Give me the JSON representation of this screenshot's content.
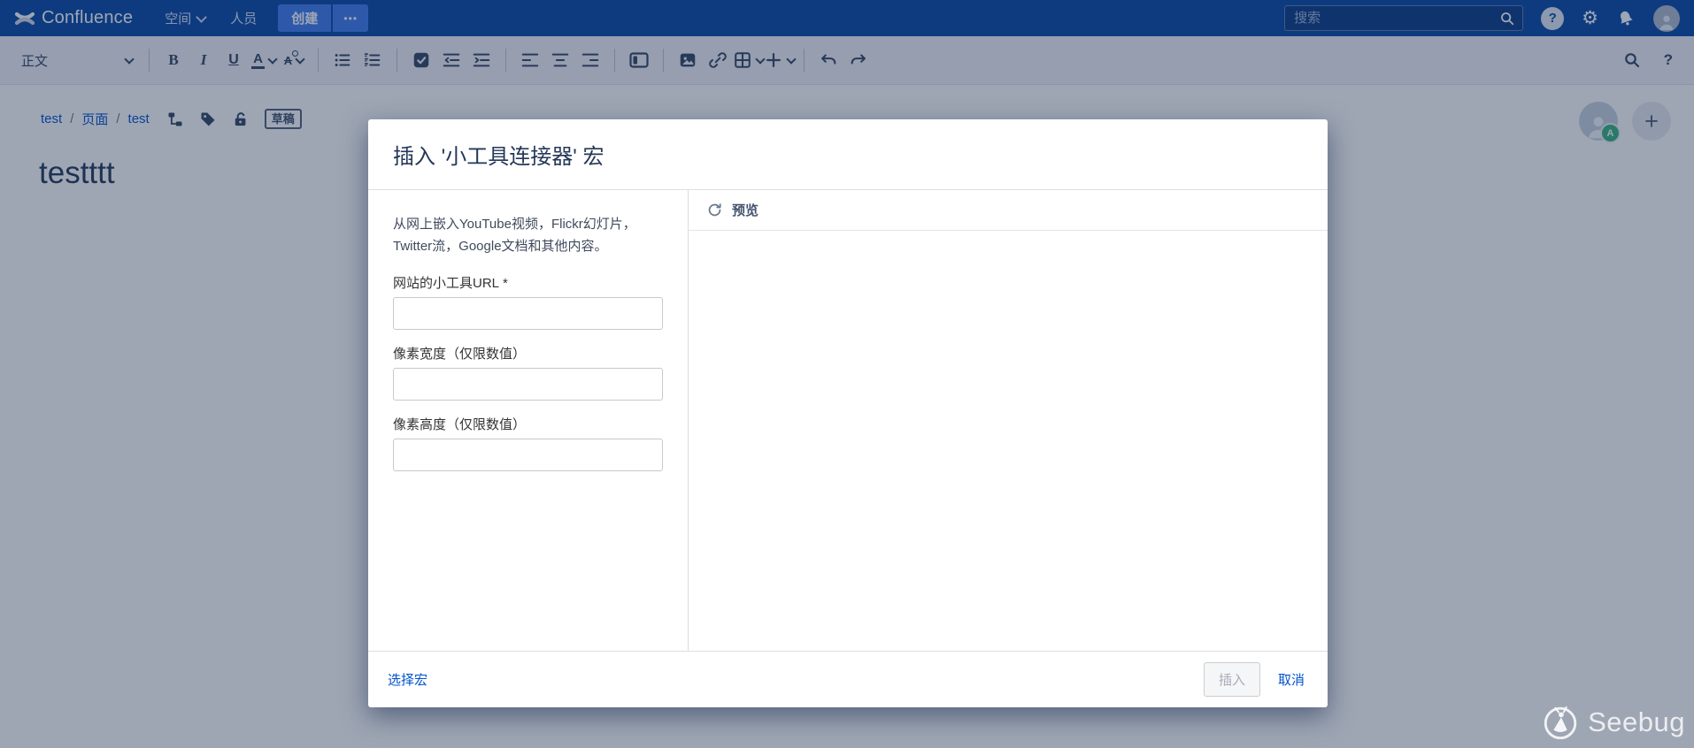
{
  "navbar": {
    "brand": "Confluence",
    "menu": {
      "spaces": "空间",
      "people": "人员",
      "create": "创建",
      "more": "•••"
    },
    "search_placeholder": "搜索"
  },
  "toolbar": {
    "paragraph_style": "正文",
    "glyphs": {
      "bold": "B",
      "italic": "I",
      "underline": "U",
      "text_color": "A",
      "more_formatting": "A",
      "help": "?"
    }
  },
  "breadcrumb": {
    "items": [
      "test",
      "页面",
      "test"
    ],
    "separator": "/",
    "draft_badge": "草稿"
  },
  "page": {
    "title": "testttt",
    "collaborator_badge": "A"
  },
  "modal": {
    "title": "插入 '小工具连接器' 宏",
    "description": "从网上嵌入YouTube视频，Flickr幻灯片，Twitter流，Google文档和其他内容。",
    "required_mark": "*",
    "fields": [
      {
        "label": "网站的小工具URL",
        "required": true,
        "value": ""
      },
      {
        "label": "像素宽度（仅限数值）",
        "required": false,
        "value": ""
      },
      {
        "label": "像素高度（仅限数值）",
        "required": false,
        "value": ""
      }
    ],
    "preview": {
      "label": "预览"
    },
    "footer": {
      "select_macro": "选择宏",
      "insert": "插入",
      "cancel": "取消"
    }
  },
  "watermark": {
    "text": "Seebug"
  },
  "colors": {
    "navbar_bg": "#0747A6",
    "create_button": "#3E7BF0",
    "link": "#0052CC",
    "title_text": "#253858",
    "toolbar_icon": "#344563",
    "badge_green": "#36B37E",
    "overlay": "rgba(23,43,77,0.42)"
  }
}
